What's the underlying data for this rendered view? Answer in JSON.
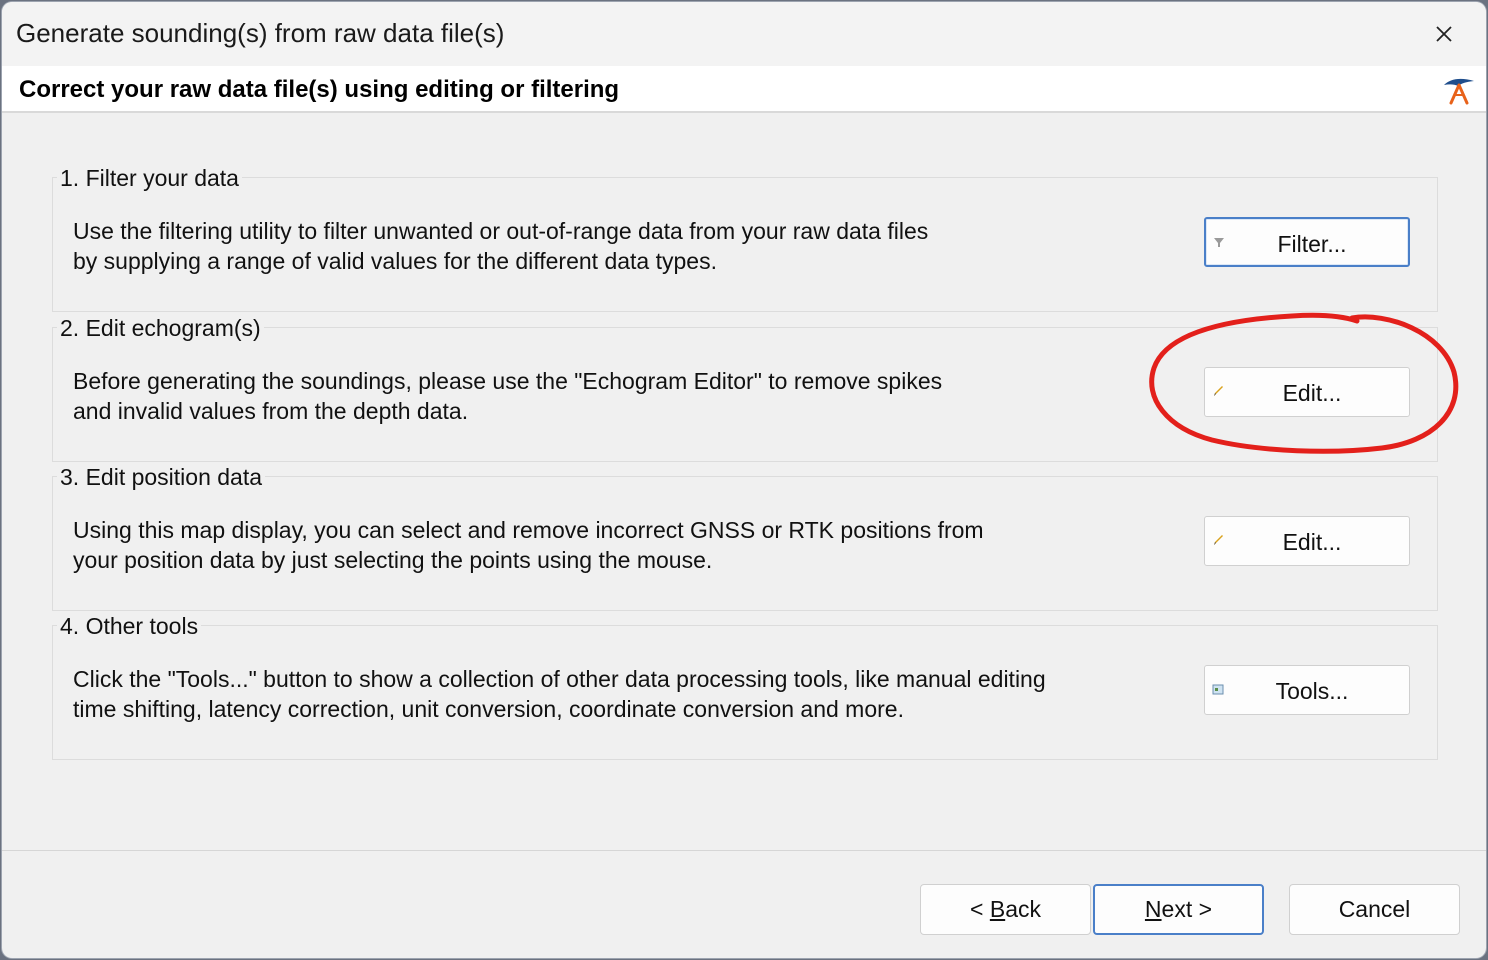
{
  "window": {
    "title": "Generate sounding(s) from raw data file(s)",
    "close_glyph": "✕"
  },
  "header": {
    "title": "Correct your raw data file(s) using editing or filtering",
    "logo_icon": "hydrographic-logo-icon"
  },
  "groups": [
    {
      "title": "1. Filter your data",
      "line1": "Use the filtering utility to filter unwanted or out-of-range data from your raw data files",
      "line2": "by supplying a range of valid values for the different data types.",
      "button_label": "Filter...",
      "button_icon": "funnel-icon"
    },
    {
      "title": "2. Edit echogram(s)",
      "line1": "Before generating the soundings, please use the \"Echogram Editor\" to remove spikes",
      "line2": "and invalid values from the depth data.",
      "button_label": "Edit...",
      "button_icon": "pencil-icon"
    },
    {
      "title": "3. Edit position data",
      "line1": "Using this map display, you can select and remove incorrect GNSS or RTK positions from",
      "line2": "your position data by just selecting the points using the mouse.",
      "button_label": "Edit...",
      "button_icon": "pencil-icon"
    },
    {
      "title": "4. Other tools",
      "line1": "Click the \"Tools...\" button to show a collection of other data processing tools, like manual editing",
      "line2": "time shifting, latency correction, unit conversion, coordinate conversion and more.",
      "button_label": "Tools...",
      "button_icon": "toolbox-icon"
    }
  ],
  "footer": {
    "back": {
      "prefix": "< ",
      "accel": "B",
      "rest": "ack"
    },
    "next": {
      "accel": "N",
      "rest": "ext >"
    },
    "cancel": "Cancel"
  },
  "colors": {
    "annotation": "#e3201b",
    "focus_border": "#4a7fc8",
    "dialog_bg": "#f0f0f0"
  }
}
